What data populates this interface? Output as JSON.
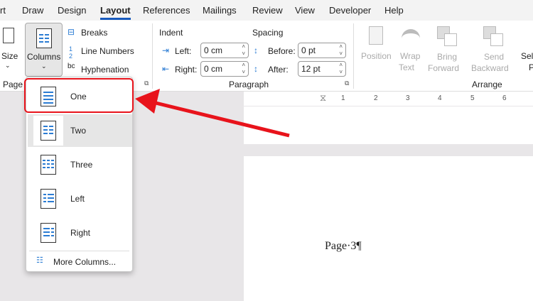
{
  "menubar": {
    "tabs": [
      "rt",
      "Draw",
      "Design",
      "Layout",
      "References",
      "Mailings",
      "Review",
      "View",
      "Developer",
      "Help"
    ],
    "active": "Layout"
  },
  "ribbon": {
    "page_setup": {
      "size": "Size",
      "columns": "Columns",
      "breaks": "Breaks",
      "line_numbers": "Line Numbers",
      "hyphenation": "Hyphenation",
      "group": "Page S"
    },
    "paragraph": {
      "indent": "Indent",
      "spacing": "Spacing",
      "left_label": "Left:",
      "left_value": "0 cm",
      "right_label": "Right:",
      "right_value": "0 cm",
      "before_label": "Before:",
      "before_value": "0 pt",
      "after_label": "After:",
      "after_value": "12 pt",
      "group": "Paragraph"
    },
    "arrange": {
      "position": "Position",
      "wrap1": "Wrap",
      "wrap2": "Text",
      "bring1": "Bring",
      "bring2": "Forward",
      "send1": "Send",
      "send2": "Backward",
      "select1": "Sele",
      "select2": "P",
      "group": "Arrange"
    }
  },
  "ruler": [
    "1",
    "2",
    "3",
    "4",
    "5",
    "6"
  ],
  "columns_menu": {
    "items": [
      "One",
      "Two",
      "Three",
      "Left",
      "Right"
    ],
    "more": "More Columns...",
    "highlighted": "One",
    "hovered": "Two"
  },
  "document": {
    "text": "Page·3¶"
  },
  "colors": {
    "accent": "#185abd",
    "annotation": "#e8131b"
  }
}
